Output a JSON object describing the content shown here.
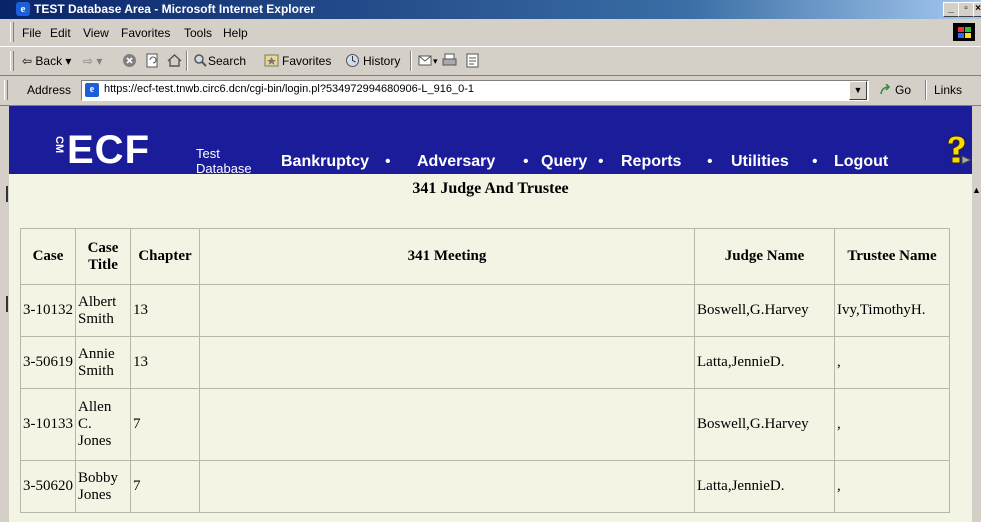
{
  "window": {
    "title": "TEST Database Area - Microsoft Internet Explorer"
  },
  "menu": [
    "File",
    "Edit",
    "View",
    "Favorites",
    "Tools",
    "Help"
  ],
  "toolbar": {
    "back": "Back",
    "search": "Search",
    "favorites": "Favorites",
    "history": "History"
  },
  "address": {
    "label": "Address",
    "url": "https://ecf-test.tnwb.circ6.dcn/cgi-bin/login.pl?534972994680906-L_916_0-1",
    "go": "Go",
    "links": "Links"
  },
  "ecf": {
    "logo": "ECF",
    "db_line1": "Test",
    "db_line2": "Database",
    "nav": [
      "Bankruptcy",
      "Adversary",
      "Query",
      "Reports",
      "Utilities",
      "Logout"
    ],
    "dot": "•"
  },
  "heading": "341 Judge And Trustee",
  "table": {
    "headers": {
      "case": "Case",
      "case_title": "Case Title",
      "chapter": "Chapter",
      "meeting": "341 Meeting",
      "judge": "Judge Name",
      "trustee": "Trustee Name"
    },
    "rows": [
      {
        "case": "3-10132",
        "title": "Albert Smith",
        "chapter": "13",
        "meeting": "",
        "judge": "Boswell,G.Harvey",
        "trustee": "Ivy,TimothyH."
      },
      {
        "case": "3-50619",
        "title": "Annie Smith",
        "chapter": "13",
        "meeting": "",
        "judge": "Latta,JennieD.",
        "trustee": ","
      },
      {
        "case": "3-10133",
        "title": "Allen C. Jones",
        "chapter": "7",
        "meeting": "",
        "judge": "Boswell,G.Harvey",
        "trustee": ","
      },
      {
        "case": "3-50620",
        "title": "Bobby Jones",
        "chapter": "7",
        "meeting": "",
        "judge": "Latta,JennieD.",
        "trustee": ","
      }
    ]
  }
}
